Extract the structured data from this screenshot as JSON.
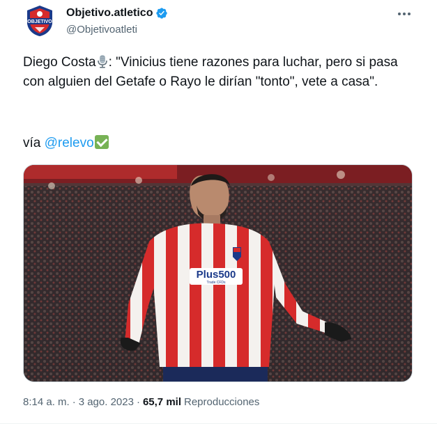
{
  "author": {
    "name": "Objetivo.atletico",
    "handle": "@Objetivoatleti",
    "avatar_text": "OBJETIVO"
  },
  "tweet": {
    "text_part1": "Diego Costa",
    "text_part2": ": \"Vinicius tiene razones para luchar, pero si pasa con alguien del Getafe o Rayo le dirían \"tonto\", vete a casa\".",
    "via_prefix": "vía ",
    "via_mention": "@relevo",
    "icons": [
      "microphone-icon",
      "check-mark-icon"
    ]
  },
  "media": {
    "jersey_sponsor": "Plus500",
    "jersey_sponsor_sub": "Trade CFDs"
  },
  "meta": {
    "time": "8:14 a. m.",
    "separator": "·",
    "date": "3 ago. 2023",
    "views_count": "65,7 mil",
    "views_label": "Reproducciones"
  },
  "colors": {
    "accent": "#1d9bf0",
    "secondary_text": "#536471",
    "primary_text": "#0f1419",
    "verified": "#1d9bf0",
    "check_box": "#77b255",
    "jersey_red": "#d62b2b"
  }
}
